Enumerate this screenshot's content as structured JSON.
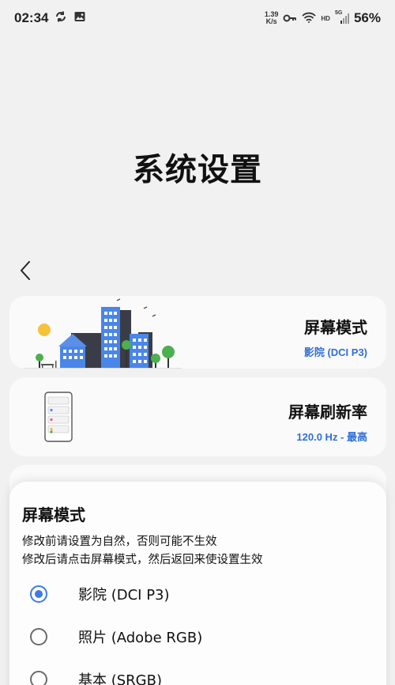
{
  "status_bar": {
    "time": "02:34",
    "net_speed_value": "1.39",
    "net_speed_unit": "K/s",
    "hd_label": "HD",
    "network_type": "5G",
    "battery": "56%",
    "icons": [
      "sync-icon",
      "gallery-icon",
      "key-icon",
      "wifi-icon",
      "signal-icon"
    ]
  },
  "page": {
    "title": "系统设置"
  },
  "cards": [
    {
      "title": "屏幕模式",
      "subtitle": "影院 (DCI P3)"
    },
    {
      "title": "屏幕刷新率",
      "subtitle": "120.0 Hz - 最高"
    }
  ],
  "sheet": {
    "title": "屏幕模式",
    "desc_line1": "修改前请设置为自然，否则可能不生效",
    "desc_line2": "修改后请点击屏幕模式，然后返回来使设置生效",
    "options": [
      {
        "label": "影院 (DCI P3)",
        "selected": true
      },
      {
        "label": "照片 (Adobe RGB)",
        "selected": false
      },
      {
        "label": "基本 (SRGB)",
        "selected": false
      }
    ]
  },
  "colors": {
    "accent": "#3d7be3",
    "subtitle": "#2f6fd8",
    "background": "#f1f1f1"
  }
}
